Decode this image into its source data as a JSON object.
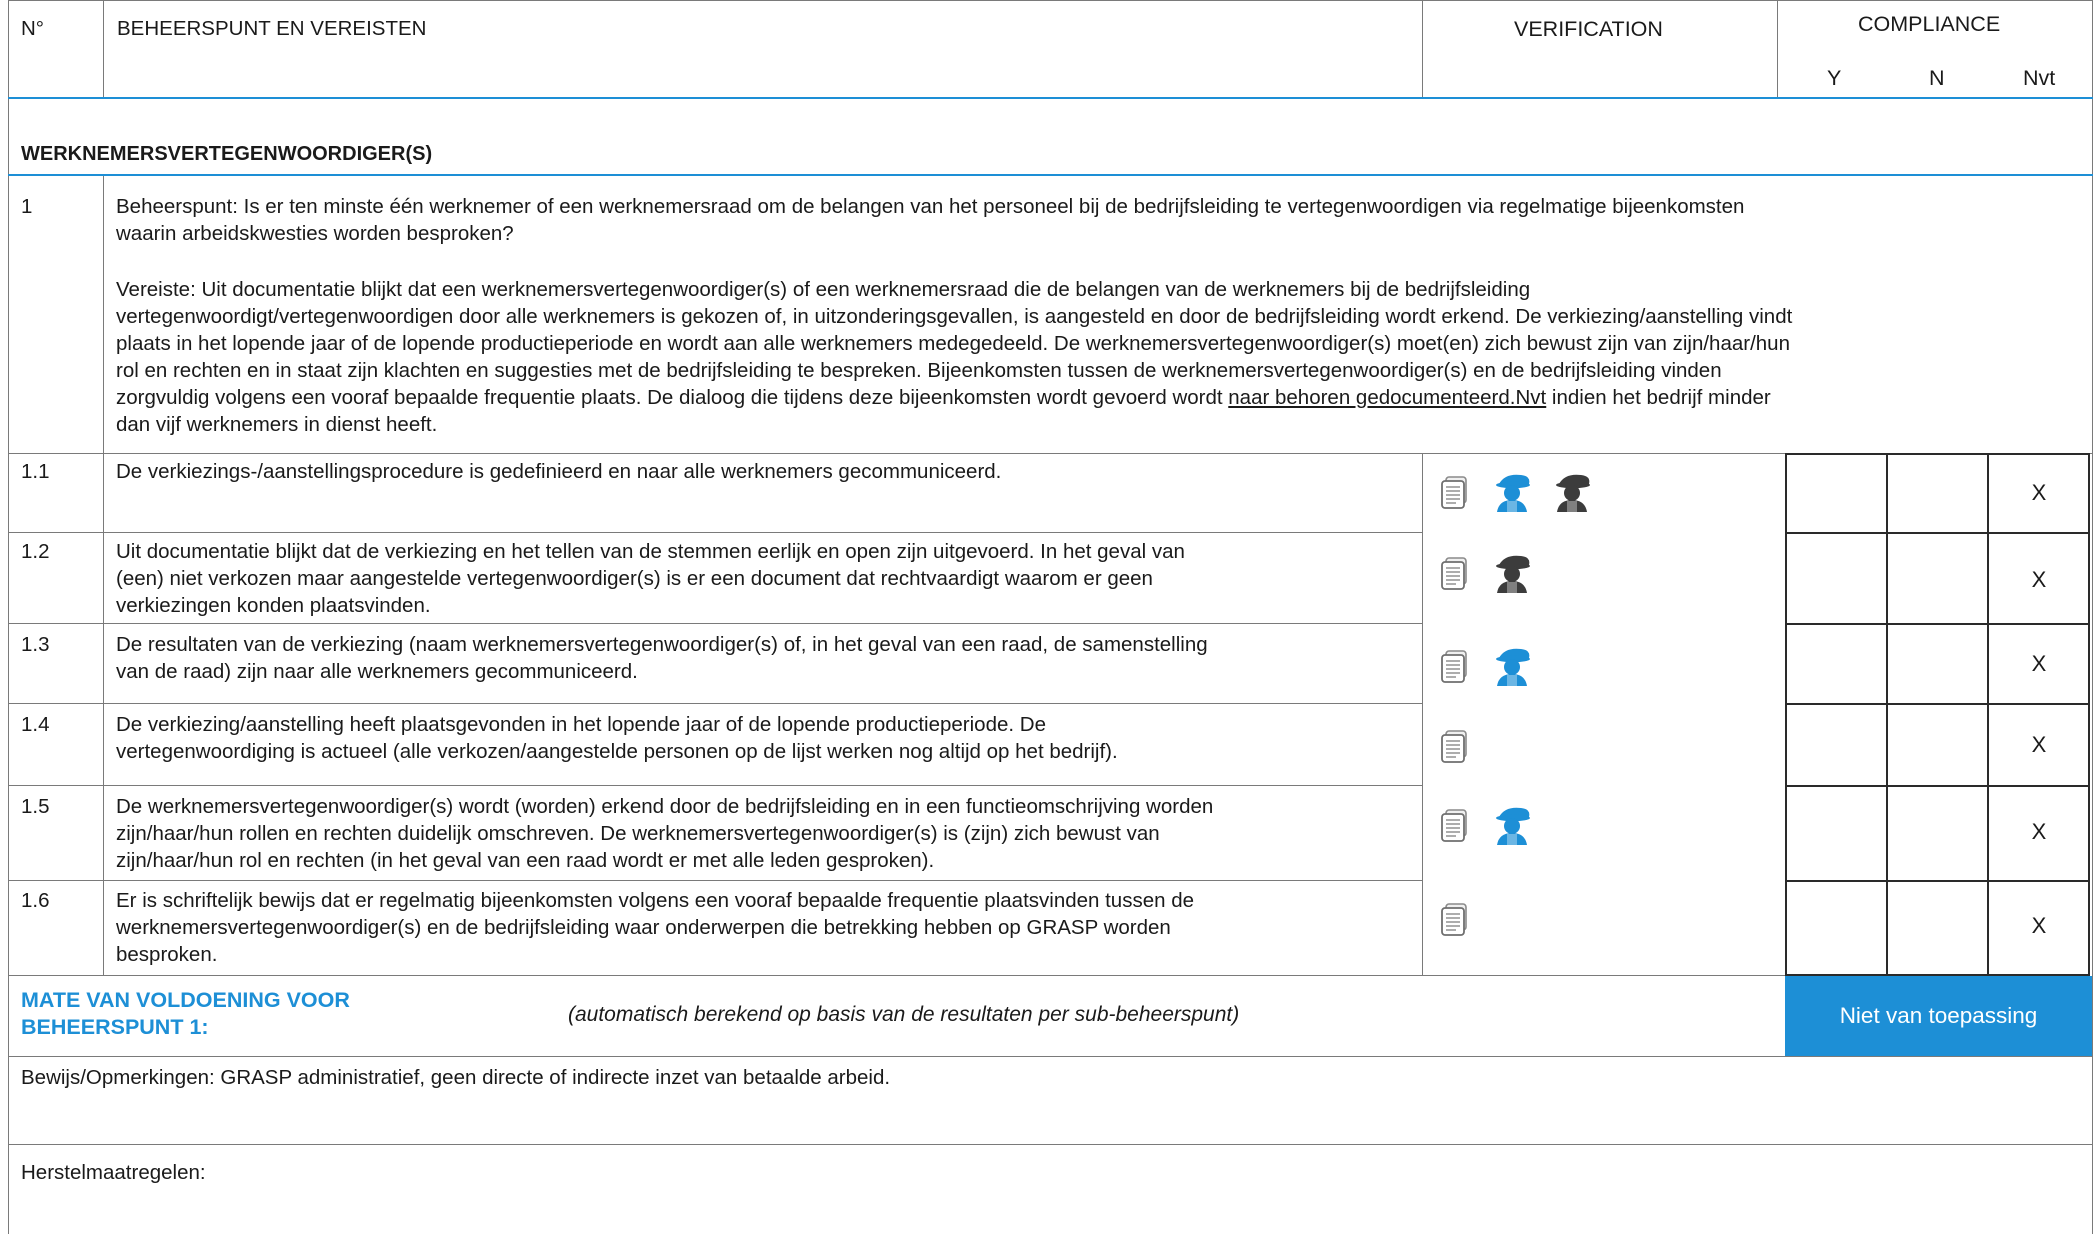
{
  "header": {
    "number": "N°",
    "requirements": "BEHEERSPUNT EN VEREISTEN",
    "verification": "VERIFICATION",
    "compliance": "COMPLIANCE",
    "y": "Y",
    "n": "N",
    "nvt": "Nvt"
  },
  "section_title": "WERKNEMERSVERTEGENWOORDIGER(S)",
  "control_point": {
    "number": "1",
    "beheerspunt_lines": [
      "Beheerspunt: Is er ten minste één werknemer of een werknemersraad om de belangen van het personeel bij de bedrijfsleiding te vertegenwoordigen via regelmatige bijeenkomsten",
      "waarin arbeidskwesties worden besproken?"
    ],
    "vereiste_lines": [
      "Vereiste: Uit documentatie blijkt dat een werknemersvertegenwoordiger(s) of een werknemersraad die de belangen van de werknemers bij de bedrijfsleiding",
      "vertegenwoordigt/vertegenwoordigen door alle werknemers is gekozen of, in uitzonderingsgevallen, is aangesteld en door de bedrijfsleiding wordt erkend. De verkiezing/aanstelling vindt",
      "plaats in het lopende jaar of de lopende productieperiode en wordt aan alle werknemers medegedeeld. De werknemersvertegenwoordiger(s) moet(en) zich bewust zijn van zijn/haar/hun",
      "rol en rechten en in staat zijn klachten en suggesties met de bedrijfsleiding te bespreken. Bijeenkomsten tussen de werknemersvertegenwoordiger(s) en de bedrijfsleiding vinden",
      "dan vijf werknemers in dienst heeft."
    ],
    "vereiste_line5_before": "zorgvuldig volgens een vooraf bepaalde frequentie plaats. De dialoog die tijdens deze bijeenkomsten wordt gevoerd wordt ",
    "vereiste_line5_underlined": "naar behoren gedocumenteerd.Nvt",
    "vereiste_line5_after": " indien het bedrijf minder"
  },
  "sub_points": [
    {
      "number": "1.1",
      "lines": [
        "De verkiezings-/aanstellingsprocedure is gedefinieerd en naar alle werknemers gecommuniceerd."
      ],
      "icons": [
        "document-icon",
        "worker-icon-blue",
        "worker-icon-dark"
      ],
      "mark": "X"
    },
    {
      "number": "1.2",
      "lines": [
        "Uit documentatie blijkt dat de verkiezing en het tellen van de stemmen eerlijk en open zijn uitgevoerd. In het geval van",
        "(een) niet verkozen maar aangestelde vertegenwoordiger(s) is er een document dat rechtvaardigt waarom er geen",
        "verkiezingen konden plaatsvinden."
      ],
      "icons": [
        "document-icon",
        "worker-icon-dark"
      ],
      "mark": "X"
    },
    {
      "number": "1.3",
      "lines": [
        "De resultaten van de verkiezing (naam werknemersvertegenwoordiger(s) of, in het geval van een raad, de samenstelling",
        "van de raad) zijn naar alle werknemers gecommuniceerd."
      ],
      "icons": [
        "document-icon",
        "worker-icon-blue"
      ],
      "mark": "X"
    },
    {
      "number": "1.4",
      "lines": [
        "De verkiezing/aanstelling heeft plaatsgevonden in het lopende jaar of de lopende productieperiode. De",
        "vertegenwoordiging is actueel (alle verkozen/aangestelde personen op de lijst werken nog altijd op het bedrijf)."
      ],
      "icons": [
        "document-icon"
      ],
      "mark": "X"
    },
    {
      "number": "1.5",
      "lines": [
        "De werknemersvertegenwoordiger(s) wordt (worden) erkend door de bedrijfsleiding en in een functieomschrijving worden",
        "zijn/haar/hun rollen en rechten duidelijk omschreven. De werknemersvertegenwoordiger(s) is (zijn) zich bewust van",
        "zijn/haar/hun rol en rechten (in het geval van een raad wordt er met alle leden gesproken)."
      ],
      "icons": [
        "document-icon",
        "worker-icon-blue"
      ],
      "mark": "X"
    },
    {
      "number": "1.6",
      "lines": [
        "Er is schriftelijk bewijs dat er regelmatig bijeenkomsten volgens een vooraf bepaalde frequentie plaatsvinden tussen de",
        "werknemersvertegenwoordiger(s) en de bedrijfsleiding waar onderwerpen die betrekking hebben op GRASP worden",
        "besproken."
      ],
      "icons": [
        "document-icon"
      ],
      "mark": "X"
    }
  ],
  "summary": {
    "title_lines": [
      "MATE VAN VOLDOENING VOOR",
      "BEHEERSPUNT 1:"
    ],
    "note": "(automatisch berekend op basis van de resultaten per sub-beheerspunt)",
    "result": "Niet van toepassing"
  },
  "evidence": "Bewijs/Opmerkingen: GRASP administratief, geen directe of indirecte inzet van betaalde arbeid.",
  "corrective": "Herstelmaatregelen:",
  "colors": {
    "accent_blue": "#1d8fd6",
    "icon_dark": "#3c3c3c",
    "icon_gray": "#8a8a8a"
  }
}
